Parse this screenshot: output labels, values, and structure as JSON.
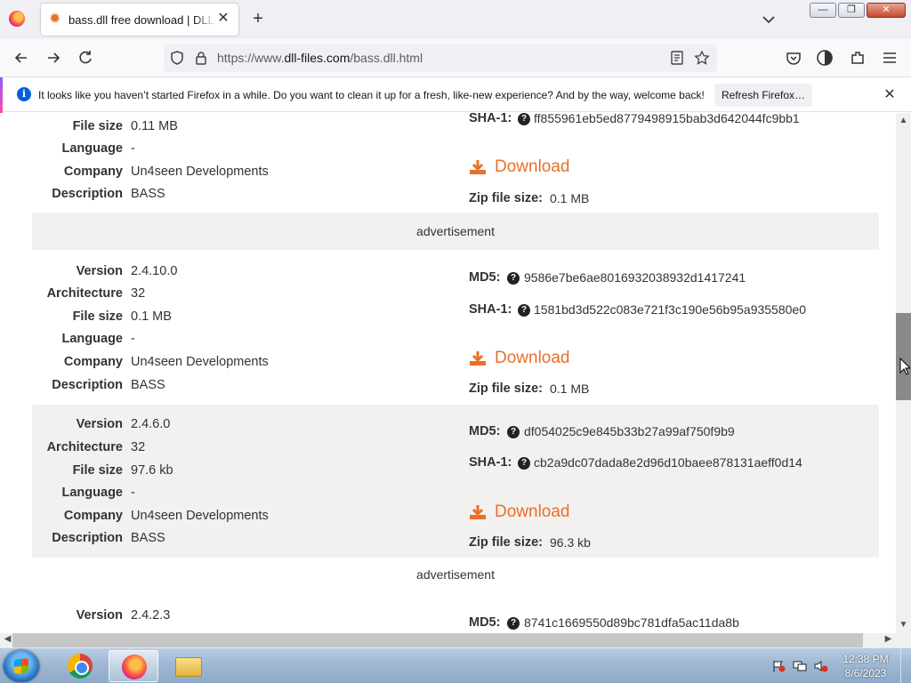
{
  "browser": {
    "tab_title": "bass.dll free download | DLL-files.com",
    "url_prefix": "https://www.",
    "url_host": "dll-files.com",
    "url_path": "/bass.dll.html",
    "new_tab_glyph": "+",
    "close_glyph": "✕",
    "window_buttons": {
      "minimize": "—",
      "restore": "❐",
      "close": "✕"
    }
  },
  "notification": {
    "text": "It looks like you haven’t started Firefox in a while. Do you want to clean it up for a fresh, like-new experience? And by the way, welcome back!",
    "button_label": "Refresh Firefox…",
    "info_glyph": "i"
  },
  "labels": {
    "version": "Version",
    "architecture": "Architecture",
    "file_size": "File size",
    "language": "Language",
    "company": "Company",
    "description": "Description",
    "md5": "MD5:",
    "sha1": "SHA-1:",
    "download": "Download",
    "zip_size": "Zip file size:",
    "advertisement": "advertisement",
    "help_glyph": "?"
  },
  "entries": [
    {
      "file_size": "0.11 MB",
      "language": "-",
      "company": "Un4seen Developments",
      "description": "BASS",
      "sha1": "ff855961eb5ed8779498915bab3d642044fc9bb1",
      "zip_size": "0.1 MB"
    },
    {
      "version": "2.4.10.0",
      "architecture": "32",
      "file_size": "0.1 MB",
      "language": "-",
      "company": "Un4seen Developments",
      "description": "BASS",
      "md5": "9586e7be6ae8016932038932d1417241",
      "sha1": "1581bd3d522c083e721f3c190e56b95a935580e0",
      "zip_size": "0.1 MB"
    },
    {
      "version": "2.4.6.0",
      "architecture": "32",
      "file_size": "97.6 kb",
      "language": "-",
      "company": "Un4seen Developments",
      "description": "BASS",
      "md5": "df054025c9e845b33b27a99af750f9b9",
      "sha1": "cb2a9dc07dada8e2d96d10baee878131aeff0d14",
      "zip_size": "96.3 kb"
    },
    {
      "version": "2.4.2.3",
      "md5": "8741c1669550d89bc781dfa5ac11da8b"
    }
  ],
  "taskbar": {
    "time": "12:38 PM",
    "date": "8/6/2023"
  },
  "colors": {
    "accent": "#e8702a",
    "row_shade": "#f3f1ef"
  }
}
